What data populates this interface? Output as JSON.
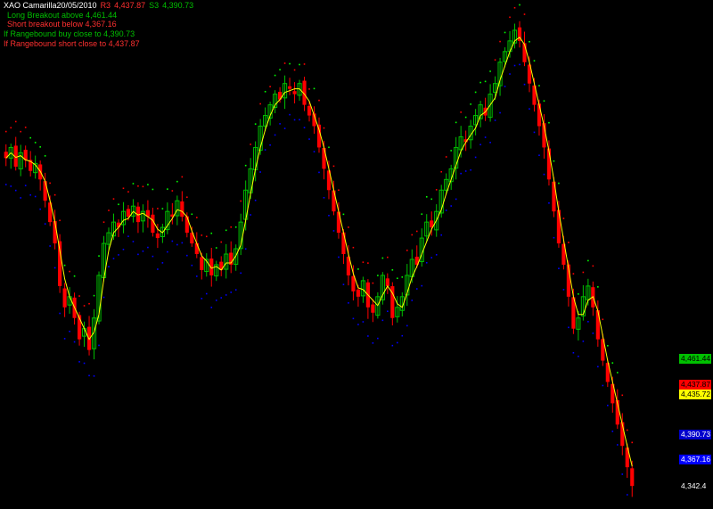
{
  "header": {
    "title": "XAO Camarilla20/05/2010",
    "r3_label": "R3",
    "r3_value": "4,437.87",
    "s3_label": "S3",
    "s3_value": "4,390.73",
    "long_breakout": "Long Breakout above  4,461.44",
    "short_breakout": "Short breakout below  4,367.16",
    "range_buy": "If Rangebound buy close to  4,390.73",
    "range_short": "If Rangebound short close to  4,437.87"
  },
  "colors": {
    "background": "#000000",
    "up_candle": "#00c000",
    "down_candle": "#ff0000",
    "moving_average": "#ffff00",
    "upper_dots": "#00ff00",
    "resistance_dots": "#ff0000",
    "lower_dots": "#0000ff",
    "label_r4": "#00c000",
    "label_r3": "#ff0000",
    "label_last": "#ffff00",
    "label_s3": "#0000cc",
    "label_s4": "#0000ff"
  },
  "chart_data": {
    "type": "candlestick",
    "ylim": [
      4330,
      4790
    ],
    "price_labels": [
      {
        "value": 4461.44,
        "text": "4,461.44",
        "color": "#00c000",
        "text_color": "#000000"
      },
      {
        "value": 4437.87,
        "text": "4,437.87",
        "color": "#ff0000",
        "text_color": "#000000"
      },
      {
        "value": 4435.72,
        "text": "4,435.72",
        "color": "#ffff00",
        "text_color": "#000000"
      },
      {
        "value": 4390.73,
        "text": "4,390.73",
        "color": "#0000cc",
        "text_color": "#ffffff"
      },
      {
        "value": 4367.16,
        "text": "4,367.16",
        "color": "#0000ff",
        "text_color": "#ffffff"
      },
      {
        "value": 4342.4,
        "text": "4,342.4",
        "color": "#000000",
        "text_color": "#ffffff"
      }
    ],
    "closes": [
      4650,
      4660,
      4642,
      4655,
      4648,
      4638,
      4645,
      4630,
      4610,
      4590,
      4570,
      4530,
      4510,
      4520,
      4500,
      4480,
      4490,
      4470,
      4500,
      4540,
      4570,
      4580,
      4590,
      4585,
      4600,
      4595,
      4605,
      4590,
      4600,
      4595,
      4580,
      4575,
      4585,
      4600,
      4595,
      4610,
      4595,
      4580,
      4570,
      4560,
      4545,
      4555,
      4540,
      4550,
      4545,
      4560,
      4550,
      4565,
      4590,
      4620,
      4640,
      4660,
      4680,
      4690,
      4700,
      4710,
      4705,
      4720,
      4715,
      4710,
      4720,
      4700,
      4690,
      4680,
      4660,
      4640,
      4620,
      4600,
      4580,
      4560,
      4540,
      4525,
      4520,
      4535,
      4510,
      4505,
      4520,
      4540,
      4530,
      4500,
      4510,
      4520,
      4540,
      4555,
      4550,
      4575,
      4590,
      4585,
      4600,
      4620,
      4630,
      4640,
      4660,
      4670,
      4665,
      4680,
      4690,
      4700,
      4690,
      4710,
      4720,
      4740,
      4750,
      4760,
      4770,
      4760,
      4740,
      4720,
      4700,
      4680,
      4660,
      4630,
      4600,
      4570,
      4550,
      4520,
      4490,
      4500,
      4520,
      4530,
      4510,
      4480,
      4460,
      4440,
      4420,
      4400,
      4380,
      4360,
      4342.4
    ]
  }
}
